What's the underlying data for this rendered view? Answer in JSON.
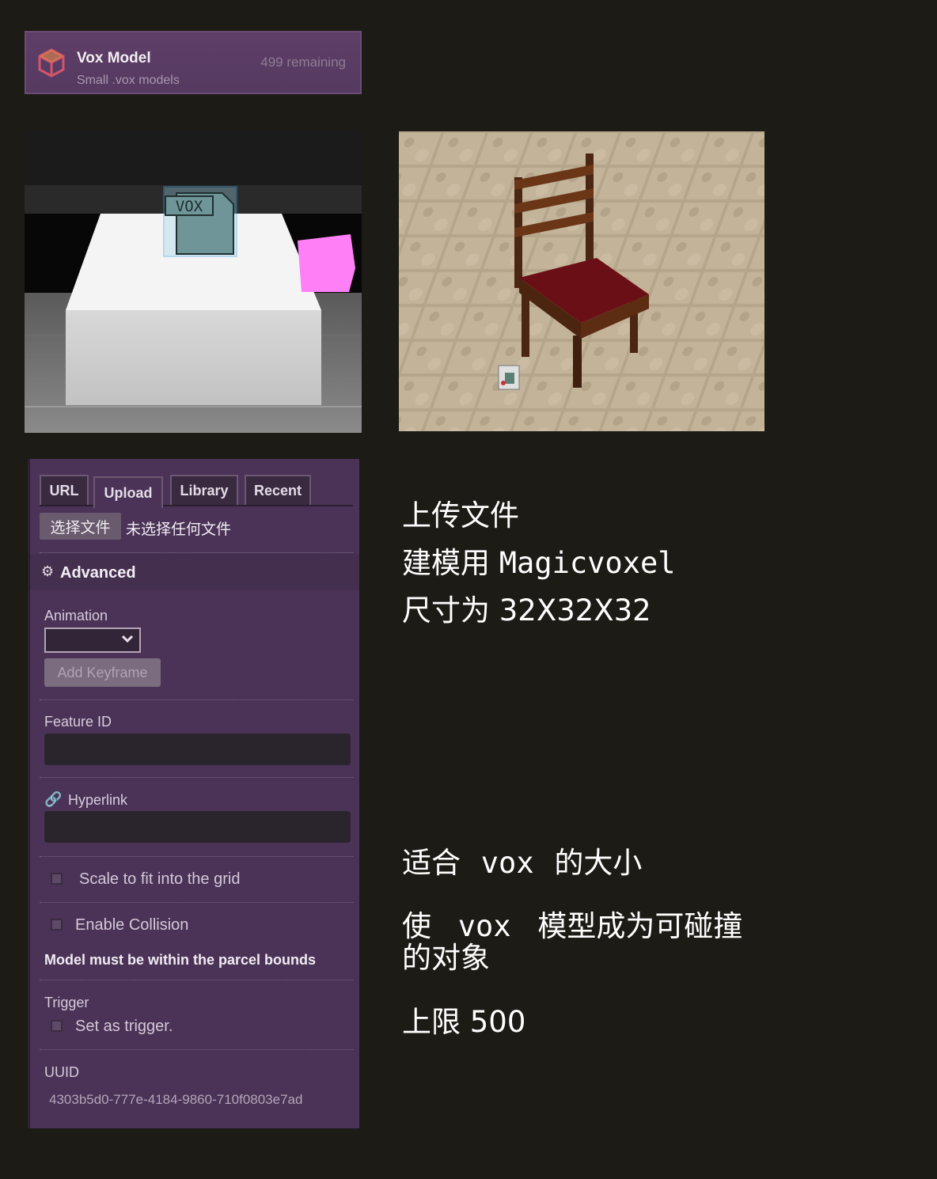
{
  "card": {
    "title": "Vox Model",
    "subtitle": "Small .vox models",
    "remaining": "499 remaining",
    "logo": "vox-cube-logo"
  },
  "scene_badge": "VOX",
  "panel": {
    "tabs": [
      "URL",
      "Upload",
      "Library",
      "Recent"
    ],
    "active_tab": "Upload",
    "file_button": "选择文件",
    "file_status": "未选择任何文件",
    "advanced": "Advanced",
    "animation_label": "Animation",
    "animation_value": "",
    "add_keyframe": "Add Keyframe",
    "feature_id_label": "Feature ID",
    "feature_id_value": "",
    "hyperlink_label": "Hyperlink",
    "hyperlink_value": "",
    "scale_option": "Scale to fit into the grid",
    "collision_option": "Enable Collision",
    "collision_warning": "Model must be within the parcel bounds",
    "trigger_label": "Trigger",
    "trigger_option": "Set as trigger.",
    "uuid_label": "UUID",
    "uuid_value": "4303b5d0-777e-4184-9860-710f0803e7ad"
  },
  "notes": {
    "upload": "上传文件",
    "modeling_prefix": "建模用",
    "modeling_tool": "Magicvoxel",
    "size_prefix": "尺寸为",
    "size_value": "32X32X32",
    "fit_a": "适合",
    "fit_b": "vox",
    "fit_c": "的大小",
    "collide_a": "使",
    "collide_b": "vox",
    "collide_c": "模型成为可碰撞",
    "collide_d": "的对象",
    "limit_prefix": "上限",
    "limit_value": "500"
  },
  "colors": {
    "panel": "#4b3357",
    "background": "#1c1b16",
    "magenta": "#ff80f6",
    "seat": "#6b0f17"
  }
}
